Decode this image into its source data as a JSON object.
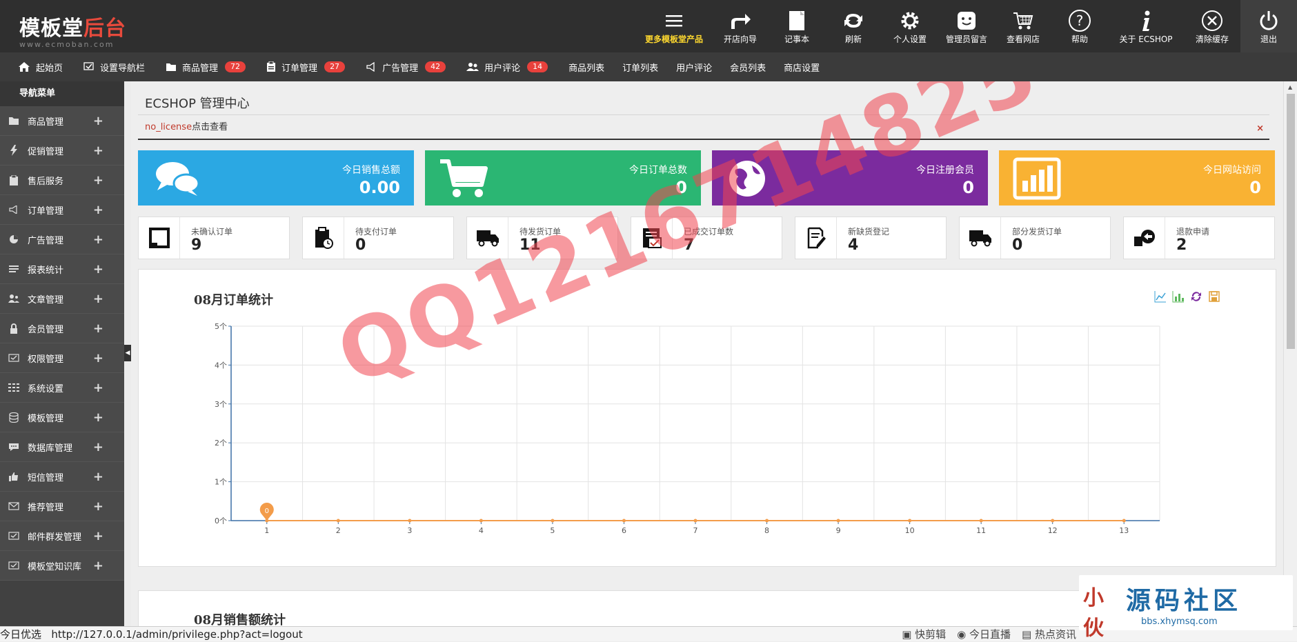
{
  "logo": {
    "text_main": "模板堂",
    "text_red": "后台",
    "url": "www.ecmoban.com"
  },
  "topnav": [
    {
      "label": "更多模板堂产品",
      "icon": "menu-icon"
    },
    {
      "label": "开店向导",
      "icon": "forward-arrow-icon"
    },
    {
      "label": "记事本",
      "icon": "notepad-icon"
    },
    {
      "label": "刷新",
      "icon": "refresh-icon"
    },
    {
      "label": "个人设置",
      "icon": "gear-icon"
    },
    {
      "label": "管理员留言",
      "icon": "smiley-icon"
    },
    {
      "label": "查看网店",
      "icon": "cart-icon"
    },
    {
      "label": "帮助",
      "icon": "help-icon"
    },
    {
      "label": "关于 ECSHOP",
      "icon": "info-icon"
    },
    {
      "label": "清除缓存",
      "icon": "close-circle-icon"
    },
    {
      "label": "退出",
      "icon": "power-icon"
    }
  ],
  "navbar": {
    "items": [
      {
        "label": "起始页",
        "icon": "home-icon"
      },
      {
        "label": "设置导航栏",
        "icon": "checkbox-icon"
      },
      {
        "label": "商品管理",
        "icon": "folder-icon",
        "badge": "72"
      },
      {
        "label": "订单管理",
        "icon": "clipboard-icon",
        "badge": "27"
      },
      {
        "label": "广告管理",
        "icon": "megaphone-icon",
        "badge": "42"
      },
      {
        "label": "用户评论",
        "icon": "users-icon",
        "badge": "14"
      }
    ],
    "links": [
      "商品列表",
      "订单列表",
      "用户评论",
      "会员列表",
      "商店设置"
    ]
  },
  "sidebar": {
    "title": "导航菜单",
    "items": [
      {
        "label": "商品管理",
        "icon": "folder-icon"
      },
      {
        "label": "促销管理",
        "icon": "lightning-icon"
      },
      {
        "label": "售后服务",
        "icon": "clipboard-icon"
      },
      {
        "label": "订单管理",
        "icon": "megaphone-icon"
      },
      {
        "label": "广告管理",
        "icon": "pie-icon"
      },
      {
        "label": "报表统计",
        "icon": "list-icon"
      },
      {
        "label": "文章管理",
        "icon": "users-icon"
      },
      {
        "label": "会员管理",
        "icon": "lock-icon"
      },
      {
        "label": "权限管理",
        "icon": "check-monitor-icon"
      },
      {
        "label": "系统设置",
        "icon": "grid-icon"
      },
      {
        "label": "模板管理",
        "icon": "database-icon"
      },
      {
        "label": "数据库管理",
        "icon": "chat-icon"
      },
      {
        "label": "短信管理",
        "icon": "thumbs-up-icon"
      },
      {
        "label": "推荐管理",
        "icon": "envelope-icon"
      },
      {
        "label": "邮件群发管理",
        "icon": "check-monitor-icon"
      },
      {
        "label": "模板堂知识库",
        "icon": "check-monitor-icon"
      }
    ]
  },
  "main": {
    "title": "ECSHOP 管理中心",
    "notice_license": "no_license",
    "notice_text": "点击查看",
    "notice_close": "×"
  },
  "stats": [
    {
      "label": "今日销售总额",
      "value": "0.00",
      "color": "#2ba8e3",
      "icon": "chat-bubbles-icon"
    },
    {
      "label": "今日订单总数",
      "value": "0",
      "color": "#2bb673",
      "icon": "cart-icon"
    },
    {
      "label": "今日注册会员",
      "value": "0",
      "color": "#7b2b9e",
      "icon": "globe-icon"
    },
    {
      "label": "今日网站访问",
      "value": "0",
      "color": "#f9b233",
      "icon": "bar-chart-icon"
    }
  ],
  "cards": [
    {
      "label": "未确认订单",
      "value": "9",
      "icon": "square-icon"
    },
    {
      "label": "待支付订单",
      "value": "0",
      "icon": "clipboard-clock-icon"
    },
    {
      "label": "待发货订单",
      "value": "11",
      "icon": "truck-icon"
    },
    {
      "label": "已成交订单数",
      "value": "7",
      "icon": "checklist-icon"
    },
    {
      "label": "新缺货登记",
      "value": "4",
      "icon": "edit-doc-icon"
    },
    {
      "label": "部分发货订单",
      "value": "0",
      "icon": "truck-icon"
    },
    {
      "label": "退款申请",
      "value": "2",
      "icon": "refund-icon"
    }
  ],
  "chart_data": {
    "type": "line",
    "title": "08月订单统计",
    "categories": [
      "1",
      "2",
      "3",
      "4",
      "5",
      "6",
      "7",
      "8",
      "9",
      "10",
      "11",
      "12",
      "13"
    ],
    "series": [
      {
        "values": [
          0,
          0,
          0,
          0,
          0,
          0,
          0,
          0,
          0,
          0,
          0,
          0,
          0
        ]
      }
    ],
    "yticks": [
      "0个",
      "1个",
      "2个",
      "3个",
      "4个",
      "5个"
    ],
    "ylim": [
      0,
      5
    ],
    "grid": true,
    "point_label": "0",
    "colors": {
      "line": "#f39c4a",
      "axis": "#3a6ea5"
    }
  },
  "chart2": {
    "title": "08月销售额统计"
  },
  "statusbar": {
    "prefix": "今日优选",
    "url": "http://127.0.0.1/admin/privilege.php?act=logout",
    "right": [
      "快剪辑",
      "今日直播",
      "热点资讯"
    ]
  },
  "watermark": "QQ1216714825",
  "brand": {
    "name": "源码社区",
    "url": "bbs.xhymsq.com",
    "seal": "小伙"
  }
}
